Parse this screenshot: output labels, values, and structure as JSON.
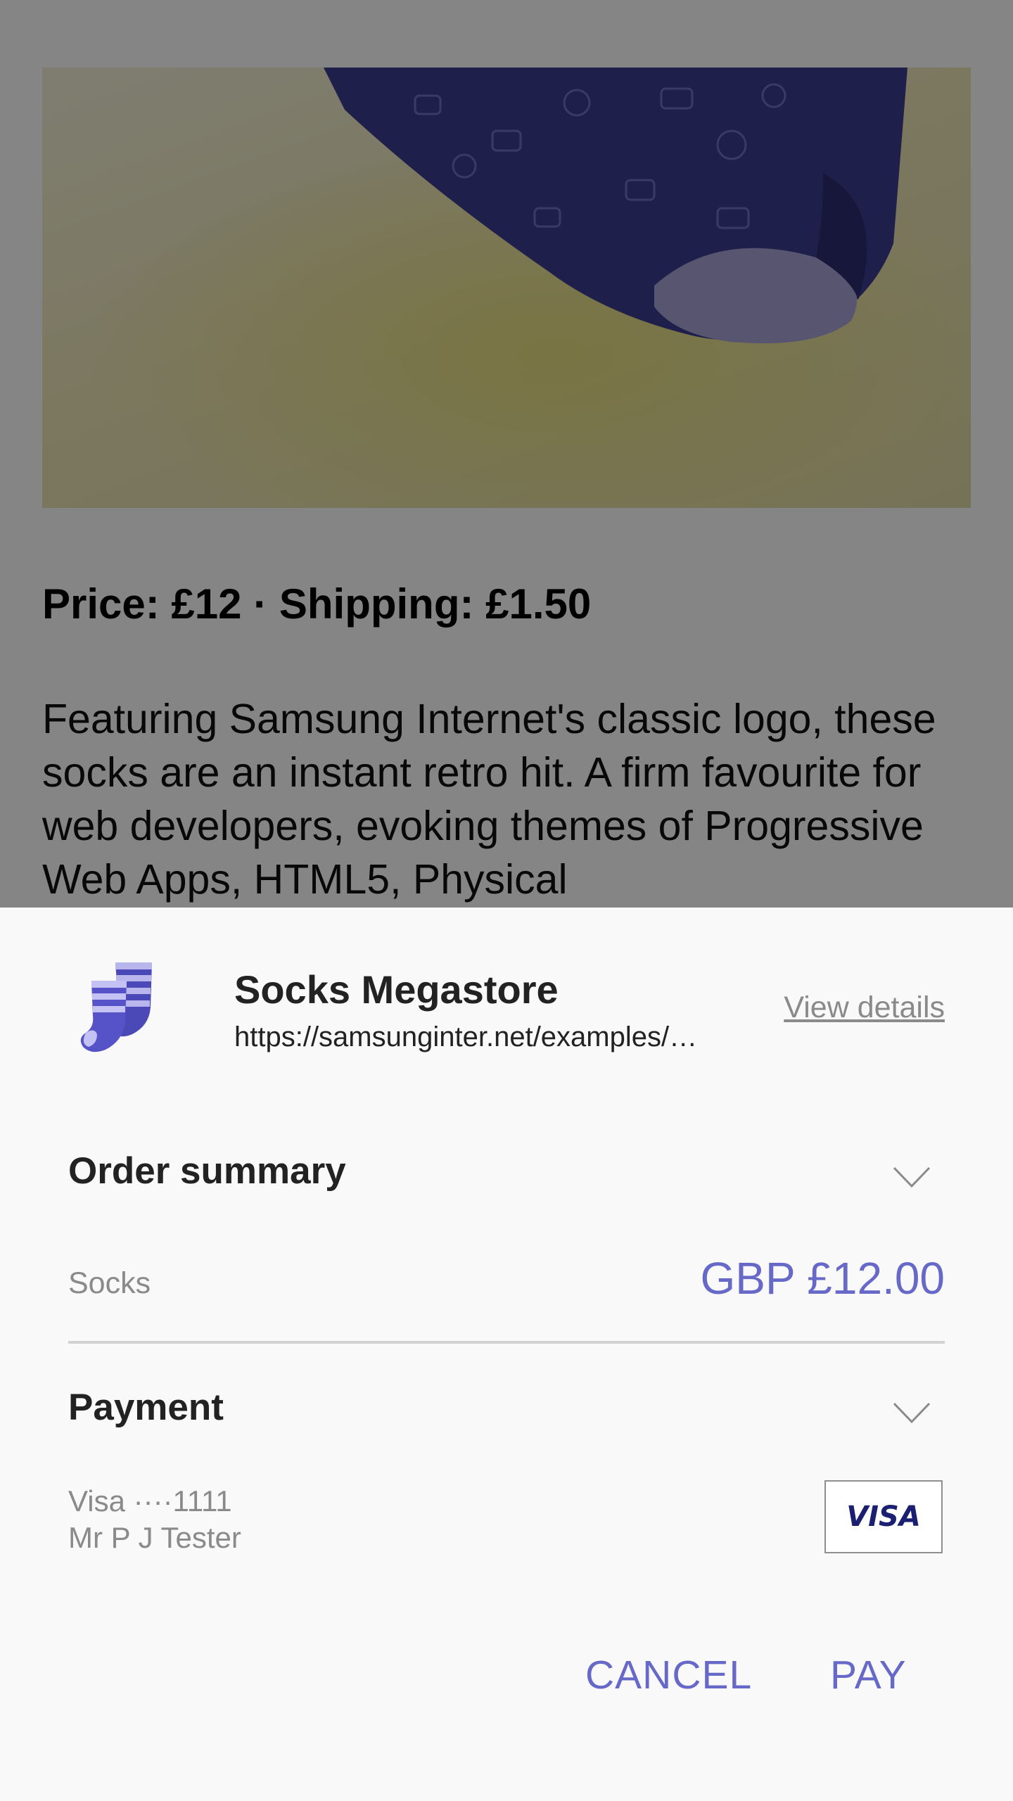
{
  "product": {
    "price_line": "Price: £12 · Shipping: £1.50",
    "description": "Featuring Samsung Internet's classic logo, these socks are an instant retro hit. A firm favourite for web developers, evoking themes of Progressive Web Apps, HTML5, Physical"
  },
  "payment_sheet": {
    "merchant": {
      "icon": "socks-icon",
      "name": "Socks Megastore",
      "url": "https://samsunginter.net/examples/socks/",
      "view_details_label": "View details"
    },
    "order_summary": {
      "heading": "Order summary",
      "item_label": "Socks",
      "total": "GBP £12.00"
    },
    "payment": {
      "heading": "Payment",
      "card_number": "Visa ····1111",
      "cardholder": "Mr P J Tester",
      "card_brand": "VISA"
    },
    "actions": {
      "cancel_label": "CANCEL",
      "pay_label": "PAY"
    }
  },
  "colors": {
    "accent": "#6769c9",
    "visa_blue": "#1a1f71"
  }
}
